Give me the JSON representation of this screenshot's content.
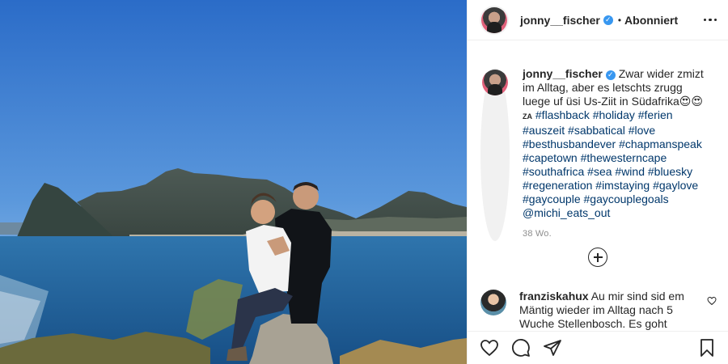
{
  "post": {
    "author": "jonny__fischer",
    "follow_state": "Abonniert",
    "dot": "•",
    "verified_glyph": "✓",
    "caption_text": "Zwar wider zmizt im Alltag, aber es letschts zrugg luege uf üsi Us-Ziit in Südafrika",
    "caption_emoji": "😍😍",
    "caption_flag": "ZA",
    "hashtags": "#flashback #holiday #ferien #auszeit #sabbatical #love #besthusbandever #chapmanspeak #capetown #thewesterncape #southafrica #sea #wind #bluesky #regeneration #imstaying #gaylove #gaycouple #gaycouplegoals @michi_eats_out",
    "time_ago": "38 Wo."
  },
  "comments": [
    {
      "user": "franziskahux",
      "text": "Au mir sind sid em Mäntig wieder im Alltag nach 5 Wuche Stellenbosch. Es goht mer"
    }
  ],
  "icons": {
    "more": "more-options-icon",
    "load_more": "plus-circle-icon",
    "like": "heart-icon",
    "comment": "comment-icon",
    "share": "paper-plane-icon",
    "save": "bookmark-icon",
    "comment_like": "small-heart-icon"
  },
  "colors": {
    "link": "#00376b",
    "verified": "#3897f0",
    "muted": "#8e8e8e",
    "border": "#efefef",
    "sky_top": "#2f6fc9",
    "sea": "#1e5f9a"
  }
}
